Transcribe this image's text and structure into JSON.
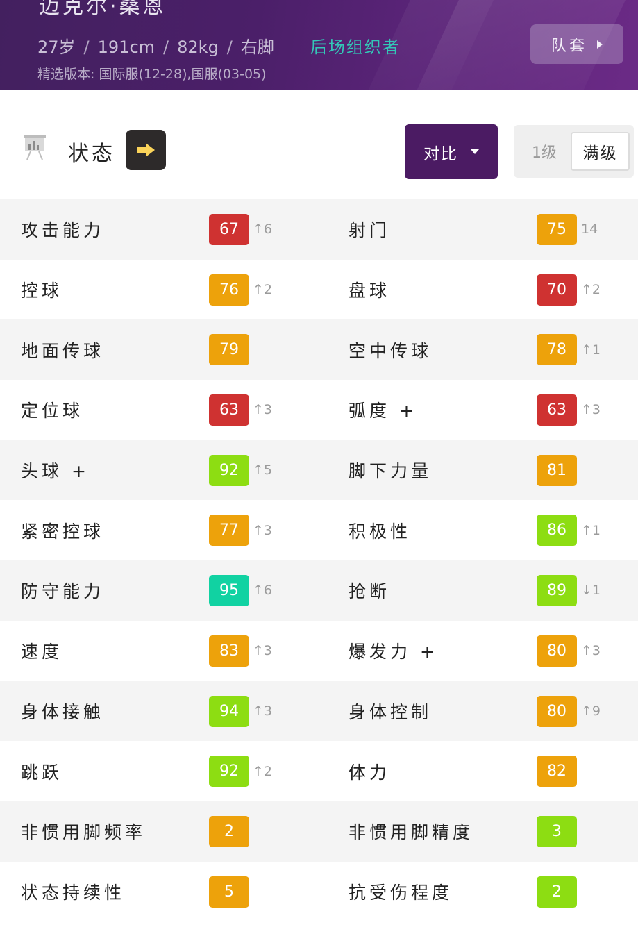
{
  "header": {
    "player_name": "迈克尔·桑恩",
    "age": "27岁",
    "height": "191cm",
    "weight": "82kg",
    "foot": "右脚",
    "separator": "/",
    "role": "后场组织者",
    "version_label": "精选版本: 国际服(12-28),国服(03-05)",
    "squad_button": "队套"
  },
  "toolbar": {
    "status_label": "状态",
    "compare_label": "对比",
    "level_1": "1级",
    "level_max": "满级",
    "level_selected": "满级"
  },
  "colors": {
    "red": "#cf3231",
    "orange": "#eda20b",
    "lime": "#8ddd12",
    "teal": "#11d2a2",
    "header_purple": "#4b1f69",
    "compare_purple": "#4b1b63"
  },
  "attributes": [
    {
      "left": {
        "name": "攻击能力",
        "value": "67",
        "color": "red",
        "delta": "↑6"
      },
      "right": {
        "name": "射门",
        "value": "75",
        "color": "orange",
        "delta": "14"
      }
    },
    {
      "left": {
        "name": "控球",
        "value": "76",
        "color": "orange",
        "delta": "↑2"
      },
      "right": {
        "name": "盘球",
        "value": "70",
        "color": "red",
        "delta": "↑2"
      }
    },
    {
      "left": {
        "name": "地面传球",
        "value": "79",
        "color": "orange",
        "delta": ""
      },
      "right": {
        "name": "空中传球",
        "value": "78",
        "color": "orange",
        "delta": "↑1"
      }
    },
    {
      "left": {
        "name": "定位球",
        "value": "63",
        "color": "red",
        "delta": "↑3"
      },
      "right": {
        "name": "弧度 +",
        "value": "63",
        "color": "red",
        "delta": "↑3"
      }
    },
    {
      "left": {
        "name": "头球 +",
        "value": "92",
        "color": "lime",
        "delta": "↑5"
      },
      "right": {
        "name": "脚下力量",
        "value": "81",
        "color": "orange",
        "delta": ""
      }
    },
    {
      "left": {
        "name": "紧密控球",
        "value": "77",
        "color": "orange",
        "delta": "↑3"
      },
      "right": {
        "name": "积极性",
        "value": "86",
        "color": "lime",
        "delta": "↑1"
      }
    },
    {
      "left": {
        "name": "防守能力",
        "value": "95",
        "color": "teal",
        "delta": "↑6"
      },
      "right": {
        "name": "抢断",
        "value": "89",
        "color": "lime",
        "delta": "↓1"
      }
    },
    {
      "left": {
        "name": "速度",
        "value": "83",
        "color": "orange",
        "delta": "↑3"
      },
      "right": {
        "name": "爆发力 +",
        "value": "80",
        "color": "orange",
        "delta": "↑3"
      }
    },
    {
      "left": {
        "name": "身体接触",
        "value": "94",
        "color": "lime",
        "delta": "↑3"
      },
      "right": {
        "name": "身体控制",
        "value": "80",
        "color": "orange",
        "delta": "↑9"
      }
    },
    {
      "left": {
        "name": "跳跃",
        "value": "92",
        "color": "lime",
        "delta": "↑2"
      },
      "right": {
        "name": "体力",
        "value": "82",
        "color": "orange",
        "delta": ""
      }
    },
    {
      "left": {
        "name": "非惯用脚频率",
        "value": "2",
        "color": "orange",
        "delta": ""
      },
      "right": {
        "name": "非惯用脚精度",
        "value": "3",
        "color": "lime",
        "delta": ""
      }
    },
    {
      "left": {
        "name": "状态持续性",
        "value": "5",
        "color": "orange",
        "delta": ""
      },
      "right": {
        "name": "抗受伤程度",
        "value": "2",
        "color": "lime",
        "delta": ""
      }
    }
  ]
}
